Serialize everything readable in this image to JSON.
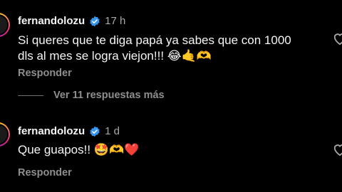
{
  "comments": [
    {
      "username": "fernandolozu",
      "time": "17 h",
      "text_line1": "Si queres que te diga papá ya sabes que con 1000",
      "text_line2": "dls al mes se logra viejon!!! ",
      "emojis": "😂🤙🫶",
      "reply_label": "Responder"
    },
    {
      "username": "fernandolozu",
      "time": "1 d",
      "text": "Que guapos!! ",
      "emojis": "🤩🫶❤️",
      "reply_label": "Responder"
    }
  ],
  "view_more": "Ver 11 respuestas más",
  "colors": {
    "background": "#000000",
    "verified": "#3797f0",
    "muted": "#8e8e8e"
  }
}
